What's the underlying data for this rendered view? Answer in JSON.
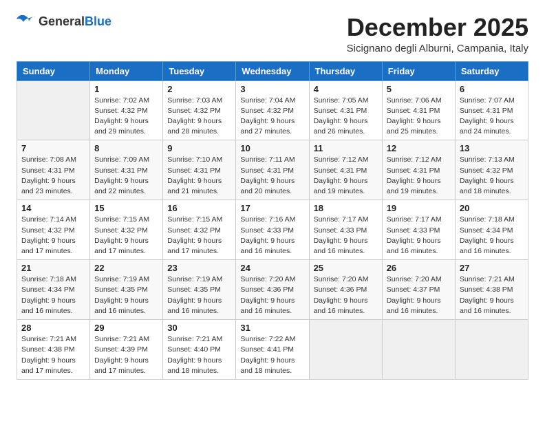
{
  "logo": {
    "general": "General",
    "blue": "Blue"
  },
  "title": "December 2025",
  "location": "Sicignano degli Alburni, Campania, Italy",
  "headers": [
    "Sunday",
    "Monday",
    "Tuesday",
    "Wednesday",
    "Thursday",
    "Friday",
    "Saturday"
  ],
  "weeks": [
    [
      {
        "day": "",
        "sunrise": "",
        "sunset": "",
        "daylight": ""
      },
      {
        "day": "1",
        "sunrise": "Sunrise: 7:02 AM",
        "sunset": "Sunset: 4:32 PM",
        "daylight": "Daylight: 9 hours and 29 minutes."
      },
      {
        "day": "2",
        "sunrise": "Sunrise: 7:03 AM",
        "sunset": "Sunset: 4:32 PM",
        "daylight": "Daylight: 9 hours and 28 minutes."
      },
      {
        "day": "3",
        "sunrise": "Sunrise: 7:04 AM",
        "sunset": "Sunset: 4:32 PM",
        "daylight": "Daylight: 9 hours and 27 minutes."
      },
      {
        "day": "4",
        "sunrise": "Sunrise: 7:05 AM",
        "sunset": "Sunset: 4:31 PM",
        "daylight": "Daylight: 9 hours and 26 minutes."
      },
      {
        "day": "5",
        "sunrise": "Sunrise: 7:06 AM",
        "sunset": "Sunset: 4:31 PM",
        "daylight": "Daylight: 9 hours and 25 minutes."
      },
      {
        "day": "6",
        "sunrise": "Sunrise: 7:07 AM",
        "sunset": "Sunset: 4:31 PM",
        "daylight": "Daylight: 9 hours and 24 minutes."
      }
    ],
    [
      {
        "day": "7",
        "sunrise": "Sunrise: 7:08 AM",
        "sunset": "Sunset: 4:31 PM",
        "daylight": "Daylight: 9 hours and 23 minutes."
      },
      {
        "day": "8",
        "sunrise": "Sunrise: 7:09 AM",
        "sunset": "Sunset: 4:31 PM",
        "daylight": "Daylight: 9 hours and 22 minutes."
      },
      {
        "day": "9",
        "sunrise": "Sunrise: 7:10 AM",
        "sunset": "Sunset: 4:31 PM",
        "daylight": "Daylight: 9 hours and 21 minutes."
      },
      {
        "day": "10",
        "sunrise": "Sunrise: 7:11 AM",
        "sunset": "Sunset: 4:31 PM",
        "daylight": "Daylight: 9 hours and 20 minutes."
      },
      {
        "day": "11",
        "sunrise": "Sunrise: 7:12 AM",
        "sunset": "Sunset: 4:31 PM",
        "daylight": "Daylight: 9 hours and 19 minutes."
      },
      {
        "day": "12",
        "sunrise": "Sunrise: 7:12 AM",
        "sunset": "Sunset: 4:31 PM",
        "daylight": "Daylight: 9 hours and 19 minutes."
      },
      {
        "day": "13",
        "sunrise": "Sunrise: 7:13 AM",
        "sunset": "Sunset: 4:32 PM",
        "daylight": "Daylight: 9 hours and 18 minutes."
      }
    ],
    [
      {
        "day": "14",
        "sunrise": "Sunrise: 7:14 AM",
        "sunset": "Sunset: 4:32 PM",
        "daylight": "Daylight: 9 hours and 17 minutes."
      },
      {
        "day": "15",
        "sunrise": "Sunrise: 7:15 AM",
        "sunset": "Sunset: 4:32 PM",
        "daylight": "Daylight: 9 hours and 17 minutes."
      },
      {
        "day": "16",
        "sunrise": "Sunrise: 7:15 AM",
        "sunset": "Sunset: 4:32 PM",
        "daylight": "Daylight: 9 hours and 17 minutes."
      },
      {
        "day": "17",
        "sunrise": "Sunrise: 7:16 AM",
        "sunset": "Sunset: 4:33 PM",
        "daylight": "Daylight: 9 hours and 16 minutes."
      },
      {
        "day": "18",
        "sunrise": "Sunrise: 7:17 AM",
        "sunset": "Sunset: 4:33 PM",
        "daylight": "Daylight: 9 hours and 16 minutes."
      },
      {
        "day": "19",
        "sunrise": "Sunrise: 7:17 AM",
        "sunset": "Sunset: 4:33 PM",
        "daylight": "Daylight: 9 hours and 16 minutes."
      },
      {
        "day": "20",
        "sunrise": "Sunrise: 7:18 AM",
        "sunset": "Sunset: 4:34 PM",
        "daylight": "Daylight: 9 hours and 16 minutes."
      }
    ],
    [
      {
        "day": "21",
        "sunrise": "Sunrise: 7:18 AM",
        "sunset": "Sunset: 4:34 PM",
        "daylight": "Daylight: 9 hours and 16 minutes."
      },
      {
        "day": "22",
        "sunrise": "Sunrise: 7:19 AM",
        "sunset": "Sunset: 4:35 PM",
        "daylight": "Daylight: 9 hours and 16 minutes."
      },
      {
        "day": "23",
        "sunrise": "Sunrise: 7:19 AM",
        "sunset": "Sunset: 4:35 PM",
        "daylight": "Daylight: 9 hours and 16 minutes."
      },
      {
        "day": "24",
        "sunrise": "Sunrise: 7:20 AM",
        "sunset": "Sunset: 4:36 PM",
        "daylight": "Daylight: 9 hours and 16 minutes."
      },
      {
        "day": "25",
        "sunrise": "Sunrise: 7:20 AM",
        "sunset": "Sunset: 4:36 PM",
        "daylight": "Daylight: 9 hours and 16 minutes."
      },
      {
        "day": "26",
        "sunrise": "Sunrise: 7:20 AM",
        "sunset": "Sunset: 4:37 PM",
        "daylight": "Daylight: 9 hours and 16 minutes."
      },
      {
        "day": "27",
        "sunrise": "Sunrise: 7:21 AM",
        "sunset": "Sunset: 4:38 PM",
        "daylight": "Daylight: 9 hours and 16 minutes."
      }
    ],
    [
      {
        "day": "28",
        "sunrise": "Sunrise: 7:21 AM",
        "sunset": "Sunset: 4:38 PM",
        "daylight": "Daylight: 9 hours and 17 minutes."
      },
      {
        "day": "29",
        "sunrise": "Sunrise: 7:21 AM",
        "sunset": "Sunset: 4:39 PM",
        "daylight": "Daylight: 9 hours and 17 minutes."
      },
      {
        "day": "30",
        "sunrise": "Sunrise: 7:21 AM",
        "sunset": "Sunset: 4:40 PM",
        "daylight": "Daylight: 9 hours and 18 minutes."
      },
      {
        "day": "31",
        "sunrise": "Sunrise: 7:22 AM",
        "sunset": "Sunset: 4:41 PM",
        "daylight": "Daylight: 9 hours and 18 minutes."
      },
      {
        "day": "",
        "sunrise": "",
        "sunset": "",
        "daylight": ""
      },
      {
        "day": "",
        "sunrise": "",
        "sunset": "",
        "daylight": ""
      },
      {
        "day": "",
        "sunrise": "",
        "sunset": "",
        "daylight": ""
      }
    ]
  ]
}
